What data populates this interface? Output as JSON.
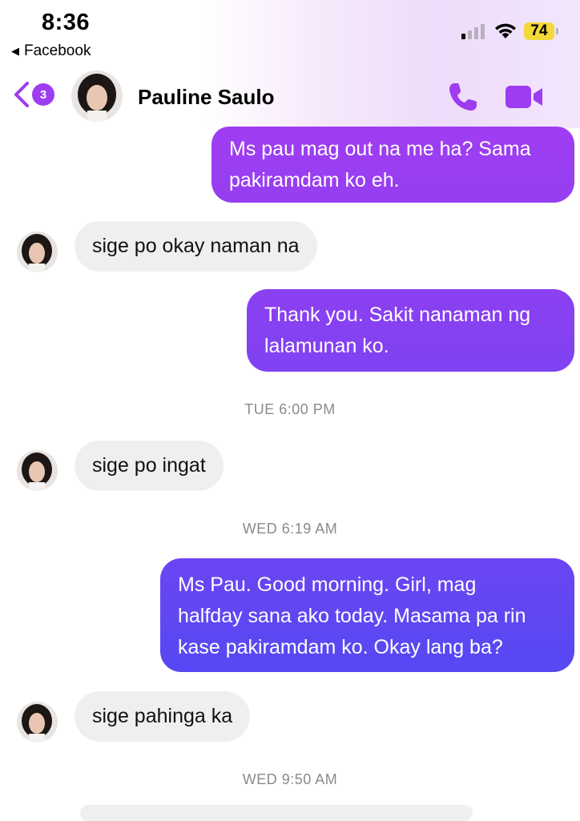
{
  "status_bar": {
    "time": "8:36",
    "back_app": "Facebook",
    "battery": "74"
  },
  "header": {
    "unread_count": "3",
    "contact_name": "Pauline Saulo"
  },
  "colors": {
    "accent": "#9d3cf0",
    "outgoing_top": "#9b3df0",
    "outgoing_bottom": "#5b47f2",
    "incoming": "#efeff2"
  },
  "messages": [
    {
      "type": "out",
      "text_lines": [
        "Ms pau mag out na me ha? Sama",
        "pakiramdam ko eh."
      ]
    },
    {
      "type": "in",
      "text": "sige po okay naman na"
    },
    {
      "type": "out",
      "text_lines": [
        "Thank you. Sakit nanaman ng",
        "lalamunan ko."
      ]
    },
    {
      "type": "timestamp",
      "text": "TUE 6:00 PM"
    },
    {
      "type": "in",
      "text": "sige po ingat"
    },
    {
      "type": "timestamp",
      "text": "WED 6:19 AM"
    },
    {
      "type": "out",
      "text_lines": [
        "Ms Pau. Good morning. Girl, mag",
        "halfday sana ako today. Masama pa rin",
        "kase pakiramdam ko. Okay lang ba?"
      ]
    },
    {
      "type": "in",
      "text": "sige pahinga ka"
    },
    {
      "type": "timestamp",
      "text": "WED 9:50 AM"
    }
  ]
}
